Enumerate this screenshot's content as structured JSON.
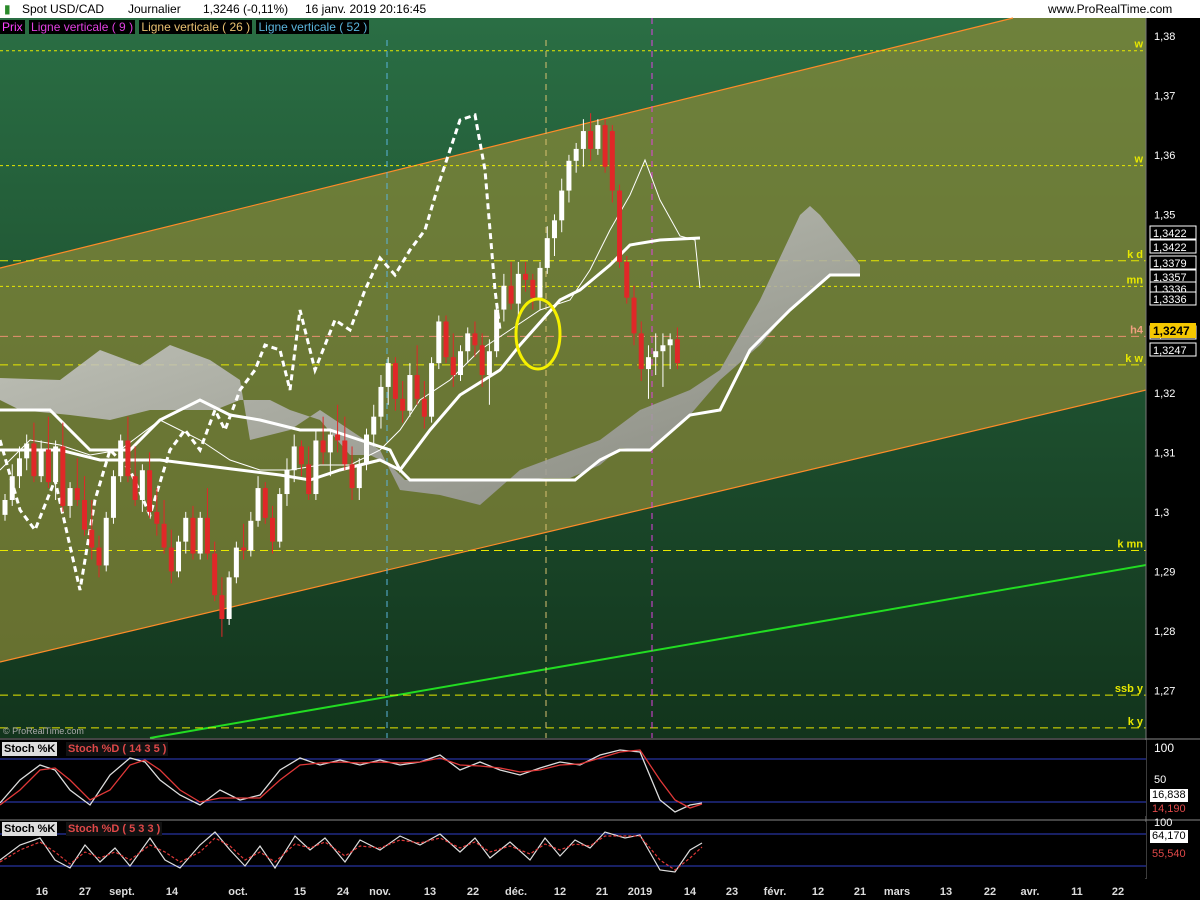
{
  "header": {
    "instrument": "Spot USD/CAD",
    "timeframe": "Journalier",
    "quote": "1,3246 (-0,11%)",
    "datetime": "16 janv. 2019 20:16:45",
    "site": "www.ProRealTime.com"
  },
  "legend": {
    "prix": "Prix",
    "lv9": "Ligne verticale ( 9 )",
    "lv26": "Ligne verticale ( 26 )",
    "lv52": "Ligne verticale ( 52 )"
  },
  "watermark": "© ProRealTime.com",
  "colors": {
    "bull": "#ffffff",
    "bear": "#e02828",
    "channel": "#ff8c28",
    "level": "#e8e800",
    "trend": "#22dd22",
    "magenta": "#e040e0",
    "cyan": "#5ab4dc",
    "tan": "#d8c070"
  },
  "chart_data": {
    "type": "candlestick",
    "ylim": [
      1.262,
      1.383
    ],
    "y_ticks": [
      "1,38",
      "1,37",
      "1,36",
      "1,35",
      "1,34",
      "1,33",
      "1,32",
      "1,31",
      "1,3",
      "1,29",
      "1,28",
      "1,27"
    ],
    "x_ticks": [
      "16",
      "27",
      "sept.",
      "14",
      "oct.",
      "15",
      "24",
      "nov.",
      "13",
      "22",
      "déc.",
      "12",
      "21",
      "2019",
      "14",
      "23",
      "févr.",
      "12",
      "21",
      "mars",
      "13",
      "22",
      "avr.",
      "11",
      "22"
    ],
    "level_lines": [
      {
        "label": "w",
        "value": 1.3775
      },
      {
        "label": "w",
        "value": 1.3582
      },
      {
        "label": "k d",
        "value": 1.3422
      },
      {
        "label": "mn",
        "value": 1.3379
      },
      {
        "label": "h4",
        "value": 1.3295
      },
      {
        "label": "k w",
        "value": 1.3247
      },
      {
        "label": "k mn",
        "value": 1.2935
      },
      {
        "label": "ssb y",
        "value": 1.2692
      },
      {
        "label": "k y",
        "value": 1.2637
      }
    ],
    "price_boxes": [
      "1,3422",
      "1,3422",
      "1,3379",
      "1,3357",
      "1,3336",
      "1,3336",
      "1,3247",
      "1,3247"
    ],
    "last_price": "1,3247",
    "candles": [
      [
        1.2995,
        1.303,
        1.2985,
        1.302
      ],
      [
        1.302,
        1.308,
        1.301,
        1.306
      ],
      [
        1.306,
        1.311,
        1.304,
        1.309
      ],
      [
        1.309,
        1.313,
        1.307,
        1.3115
      ],
      [
        1.3115,
        1.315,
        1.305,
        1.306
      ],
      [
        1.306,
        1.312,
        1.305,
        1.3105
      ],
      [
        1.3105,
        1.316,
        1.304,
        1.305
      ],
      [
        1.305,
        1.312,
        1.302,
        1.311
      ],
      [
        1.311,
        1.315,
        1.3,
        1.301
      ],
      [
        1.301,
        1.305,
        1.299,
        1.304
      ],
      [
        1.304,
        1.309,
        1.301,
        1.302
      ],
      [
        1.302,
        1.306,
        1.296,
        1.297
      ],
      [
        1.297,
        1.302,
        1.292,
        1.294
      ],
      [
        1.294,
        1.296,
        1.289,
        1.291
      ],
      [
        1.291,
        1.3,
        1.29,
        1.299
      ],
      [
        1.299,
        1.307,
        1.298,
        1.306
      ],
      [
        1.306,
        1.313,
        1.305,
        1.312
      ],
      [
        1.312,
        1.316,
        1.305,
        1.306
      ],
      [
        1.306,
        1.311,
        1.301,
        1.302
      ],
      [
        1.302,
        1.308,
        1.3,
        1.307
      ],
      [
        1.307,
        1.31,
        1.299,
        1.3
      ],
      [
        1.3,
        1.304,
        1.296,
        1.298
      ],
      [
        1.298,
        1.302,
        1.293,
        1.294
      ],
      [
        1.294,
        1.297,
        1.288,
        1.29
      ],
      [
        1.29,
        1.296,
        1.289,
        1.295
      ],
      [
        1.295,
        1.3,
        1.293,
        1.299
      ],
      [
        1.299,
        1.301,
        1.292,
        1.293
      ],
      [
        1.293,
        1.3,
        1.292,
        1.299
      ],
      [
        1.299,
        1.304,
        1.292,
        1.293
      ],
      [
        1.293,
        1.295,
        1.285,
        1.286
      ],
      [
        1.286,
        1.289,
        1.279,
        1.282
      ],
      [
        1.282,
        1.29,
        1.281,
        1.289
      ],
      [
        1.289,
        1.295,
        1.288,
        1.294
      ],
      [
        1.294,
        1.298,
        1.292,
        1.2935
      ],
      [
        1.2935,
        1.3,
        1.2925,
        1.2985
      ],
      [
        1.2985,
        1.306,
        1.2975,
        1.304
      ],
      [
        1.304,
        1.305,
        1.298,
        1.299
      ],
      [
        1.299,
        1.301,
        1.293,
        1.295
      ],
      [
        1.295,
        1.304,
        1.294,
        1.303
      ],
      [
        1.303,
        1.309,
        1.301,
        1.307
      ],
      [
        1.307,
        1.313,
        1.305,
        1.311
      ],
      [
        1.311,
        1.312,
        1.306,
        1.308
      ],
      [
        1.308,
        1.311,
        1.302,
        1.303
      ],
      [
        1.303,
        1.314,
        1.302,
        1.312
      ],
      [
        1.312,
        1.316,
        1.308,
        1.31
      ],
      [
        1.31,
        1.314,
        1.306,
        1.313
      ],
      [
        1.313,
        1.318,
        1.31,
        1.312
      ],
      [
        1.312,
        1.316,
        1.307,
        1.308
      ],
      [
        1.308,
        1.311,
        1.302,
        1.304
      ],
      [
        1.304,
        1.309,
        1.302,
        1.308
      ],
      [
        1.308,
        1.314,
        1.307,
        1.313
      ],
      [
        1.313,
        1.318,
        1.311,
        1.316
      ],
      [
        1.316,
        1.323,
        1.314,
        1.321
      ],
      [
        1.321,
        1.326,
        1.318,
        1.325
      ],
      [
        1.325,
        1.326,
        1.317,
        1.319
      ],
      [
        1.319,
        1.322,
        1.315,
        1.317
      ],
      [
        1.317,
        1.325,
        1.316,
        1.323
      ],
      [
        1.323,
        1.328,
        1.318,
        1.319
      ],
      [
        1.319,
        1.322,
        1.314,
        1.316
      ],
      [
        1.316,
        1.326,
        1.315,
        1.325
      ],
      [
        1.325,
        1.333,
        1.324,
        1.332
      ],
      [
        1.332,
        1.333,
        1.325,
        1.326
      ],
      [
        1.326,
        1.33,
        1.321,
        1.323
      ],
      [
        1.323,
        1.328,
        1.322,
        1.327
      ],
      [
        1.327,
        1.331,
        1.325,
        1.33
      ],
      [
        1.33,
        1.332,
        1.326,
        1.328
      ],
      [
        1.328,
        1.33,
        1.321,
        1.323
      ],
      [
        1.323,
        1.329,
        1.318,
        1.327
      ],
      [
        1.327,
        1.335,
        1.326,
        1.334
      ],
      [
        1.334,
        1.34,
        1.332,
        1.338
      ],
      [
        1.338,
        1.342,
        1.334,
        1.335
      ],
      [
        1.335,
        1.342,
        1.332,
        1.34
      ],
      [
        1.34,
        1.342,
        1.337,
        1.339
      ],
      [
        1.339,
        1.34,
        1.334,
        1.336
      ],
      [
        1.336,
        1.342,
        1.334,
        1.341
      ],
      [
        1.341,
        1.348,
        1.34,
        1.346
      ],
      [
        1.346,
        1.35,
        1.343,
        1.349
      ],
      [
        1.349,
        1.356,
        1.347,
        1.354
      ],
      [
        1.354,
        1.36,
        1.352,
        1.359
      ],
      [
        1.359,
        1.362,
        1.357,
        1.361
      ],
      [
        1.361,
        1.366,
        1.358,
        1.364
      ],
      [
        1.364,
        1.367,
        1.359,
        1.361
      ],
      [
        1.361,
        1.366,
        1.36,
        1.365
      ],
      [
        1.365,
        1.366,
        1.357,
        1.358
      ],
      [
        1.364,
        1.365,
        1.352,
        1.354
      ],
      [
        1.354,
        1.355,
        1.341,
        1.342
      ],
      [
        1.342,
        1.343,
        1.335,
        1.336
      ],
      [
        1.336,
        1.338,
        1.328,
        1.33
      ],
      [
        1.33,
        1.332,
        1.322,
        1.324
      ],
      [
        1.324,
        1.328,
        1.319,
        1.326
      ],
      [
        1.326,
        1.33,
        1.323,
        1.327
      ],
      [
        1.327,
        1.33,
        1.321,
        1.328
      ],
      [
        1.328,
        1.33,
        1.324,
        1.329
      ],
      [
        1.329,
        1.331,
        1.324,
        1.325
      ]
    ],
    "stoch_panel_1": {
      "title": "Stoch %K",
      "title2": "Stoch %D ( 14 3 5 )",
      "levels": [
        "100",
        "50"
      ],
      "k_value": "16,838",
      "d_value": "14,190"
    },
    "stoch_panel_2": {
      "title": "Stoch %K",
      "title2": "Stoch %D ( 5 3 3 )",
      "levels": [
        "100"
      ],
      "k_value": "64,170",
      "d_value": "55,540"
    }
  }
}
